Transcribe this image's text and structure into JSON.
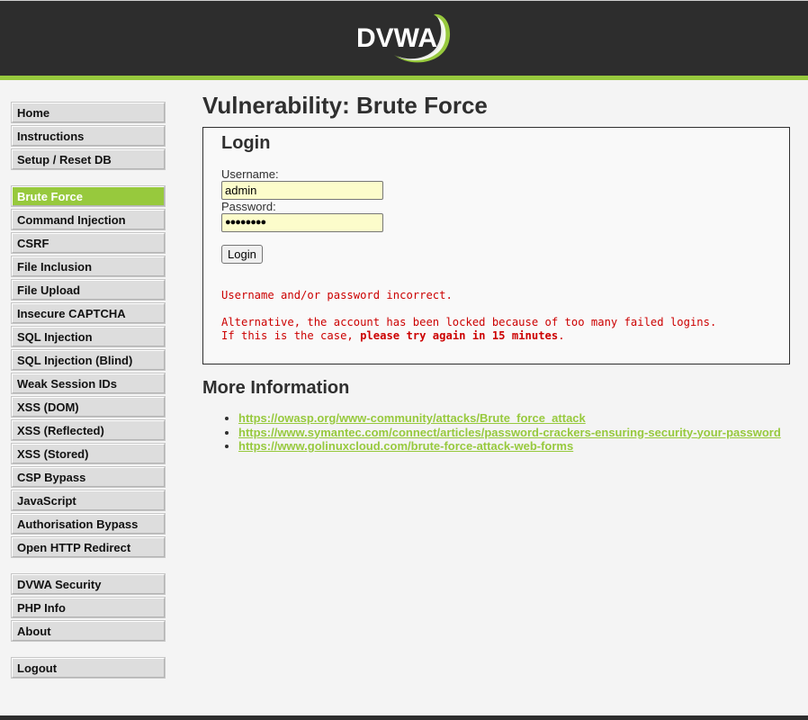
{
  "header": {
    "logo_text": "DVWA"
  },
  "menu": {
    "groups": [
      [
        {
          "label": "Home"
        },
        {
          "label": "Instructions"
        },
        {
          "label": "Setup / Reset DB"
        }
      ],
      [
        {
          "label": "Brute Force",
          "selected": true
        },
        {
          "label": "Command Injection"
        },
        {
          "label": "CSRF"
        },
        {
          "label": "File Inclusion"
        },
        {
          "label": "File Upload"
        },
        {
          "label": "Insecure CAPTCHA"
        },
        {
          "label": "SQL Injection"
        },
        {
          "label": "SQL Injection (Blind)"
        },
        {
          "label": "Weak Session IDs"
        },
        {
          "label": "XSS (DOM)"
        },
        {
          "label": "XSS (Reflected)"
        },
        {
          "label": "XSS (Stored)"
        },
        {
          "label": "CSP Bypass"
        },
        {
          "label": "JavaScript"
        },
        {
          "label": "Authorisation Bypass"
        },
        {
          "label": "Open HTTP Redirect"
        }
      ],
      [
        {
          "label": "DVWA Security"
        },
        {
          "label": "PHP Info"
        },
        {
          "label": "About"
        }
      ],
      [
        {
          "label": "Logout"
        }
      ]
    ]
  },
  "page": {
    "title": "Vulnerability: Brute Force"
  },
  "login": {
    "heading": "Login",
    "username_label": "Username:",
    "username_value": "admin",
    "password_label": "Password:",
    "password_value": "●●●●●●●●",
    "button": "Login",
    "error1": "Username and/or password incorrect.",
    "error2": "Alternative, the account has been locked because of too many failed logins.",
    "error3_prefix": "If this is the case, ",
    "error3_bold": "please try again in 15 minutes",
    "error3_suffix": "."
  },
  "more_info": {
    "title": "More Information",
    "links": [
      "https://owasp.org/www-community/attacks/Brute_force_attack",
      "https://www.symantec.com/connect/articles/password-crackers-ensuring-security-your-password",
      "https://www.golinuxcloud.com/brute-force-attack-web-forms"
    ]
  },
  "colors": {
    "accent": "#97c93d",
    "header_bg": "#2d2d2d",
    "error": "#cc0000",
    "input_bg": "#fcfccb"
  }
}
